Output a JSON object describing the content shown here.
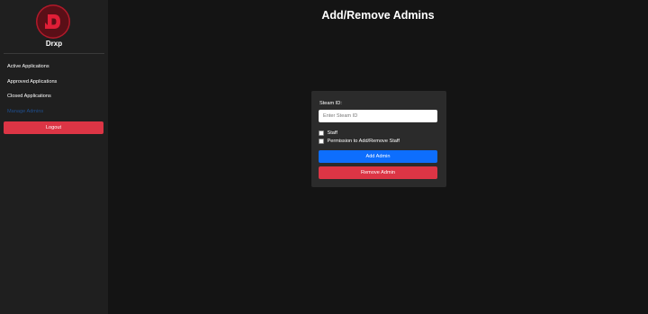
{
  "sidebar": {
    "brand": "Drxp",
    "logo_icon": "drxp-logo-icon",
    "items": [
      {
        "label": "Active Applications",
        "active": false
      },
      {
        "label": "Approved Applications",
        "active": false
      },
      {
        "label": "Closed Applications",
        "active": false
      },
      {
        "label": "Manage Admins",
        "active": true
      }
    ],
    "logout_label": "Logout"
  },
  "main": {
    "title": "Add/Remove Admins",
    "form": {
      "steam_id_label": "Steam ID:",
      "steam_id_placeholder": "Enter Steam ID",
      "steam_id_value": "",
      "staff_label": "Staff",
      "staff_checked": false,
      "permission_label": "Permission to Add/Remove Staff",
      "permission_checked": false,
      "add_label": "Add Admin",
      "remove_label": "Remove Admin"
    }
  },
  "colors": {
    "background": "#141414",
    "sidebar": "#1f1f1f",
    "card": "#2b2b2b",
    "primary": "#0d6efd",
    "danger": "#dc3545",
    "active_link": "#1f4f8f",
    "logo_red": "#b01a2a"
  }
}
